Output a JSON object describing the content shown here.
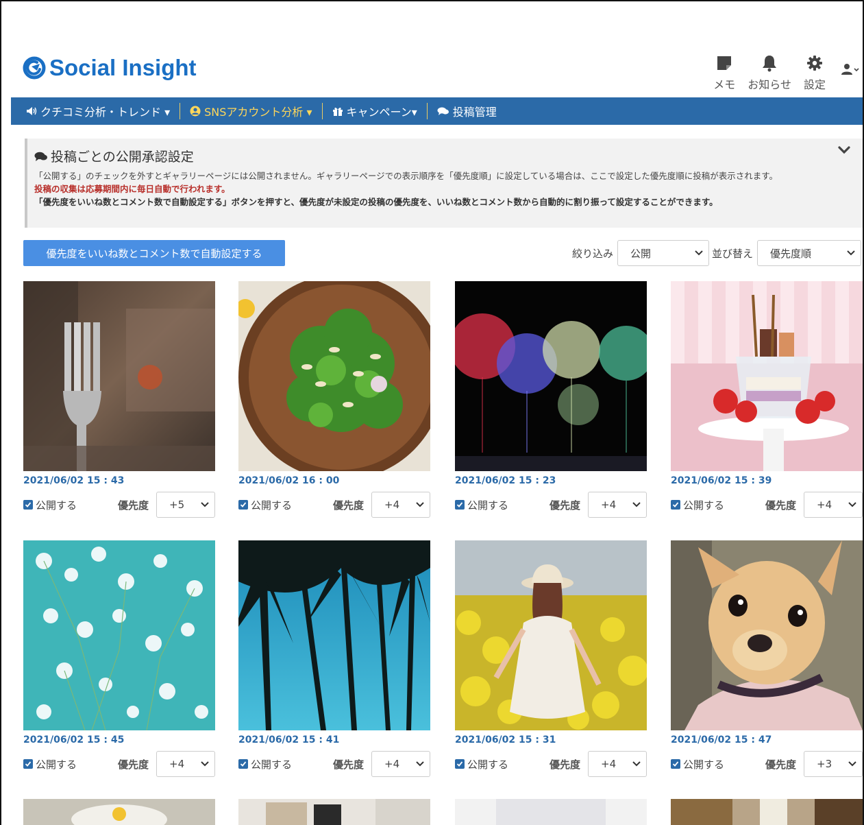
{
  "header": {
    "logo_text": "Social Insight",
    "memo_label": "メモ",
    "notice_label": "お知らせ",
    "settings_label": "設定"
  },
  "nav": {
    "items": [
      {
        "label": "クチコミ分析・トレンド ▾"
      },
      {
        "label": "SNSアカウント分析 ▾"
      },
      {
        "label": "キャンペーン▾"
      },
      {
        "label": "投稿管理"
      }
    ]
  },
  "info": {
    "title": "投稿ごとの公開承認設定",
    "line1": "「公開する」のチェックを外すとギャラリーページには公開されません。ギャラリーページでの表示順序を「優先度順」に設定している場合は、ここで設定した優先度順に投稿が表示されます。",
    "line2": "投稿の収集は応募期間内に毎日自動で行われます。",
    "line3": "「優先度をいいね数とコメント数で自動設定する」ボタンを押すと、優先度が未設定の投稿の優先度を、いいね数とコメント数から自動的に割り振って設定することができます。"
  },
  "controls": {
    "auto_button": "優先度をいいね数とコメント数で自動設定する",
    "filter_label": "絞り込み",
    "filter_value": "公開",
    "sort_label": "並び替え",
    "sort_value": "優先度順"
  },
  "card_labels": {
    "publish": "公開する",
    "priority": "優先度"
  },
  "posts": [
    {
      "date": "2021/06/02 15 : 43",
      "priority": "+5",
      "photo": "fork"
    },
    {
      "date": "2021/06/02 16 : 00",
      "priority": "+4",
      "photo": "salad"
    },
    {
      "date": "2021/06/02 15 : 23",
      "priority": "+4",
      "photo": "fireworks"
    },
    {
      "date": "2021/06/02 15 : 39",
      "priority": "+4",
      "photo": "parfait"
    },
    {
      "date": "2021/06/02 15 : 45",
      "priority": "+4",
      "photo": "flowers"
    },
    {
      "date": "2021/06/02 15 : 41",
      "priority": "+4",
      "photo": "palms"
    },
    {
      "date": "2021/06/02 15 : 31",
      "priority": "+4",
      "photo": "field"
    },
    {
      "date": "2021/06/02 15 : 47",
      "priority": "+3",
      "photo": "dog"
    }
  ],
  "colors": {
    "brand": "#1a6fc4",
    "nav_bg": "#2b6aa8",
    "nav_active": "#ffd75a",
    "button": "#4a8fe3",
    "alert_red": "#b8302b"
  }
}
